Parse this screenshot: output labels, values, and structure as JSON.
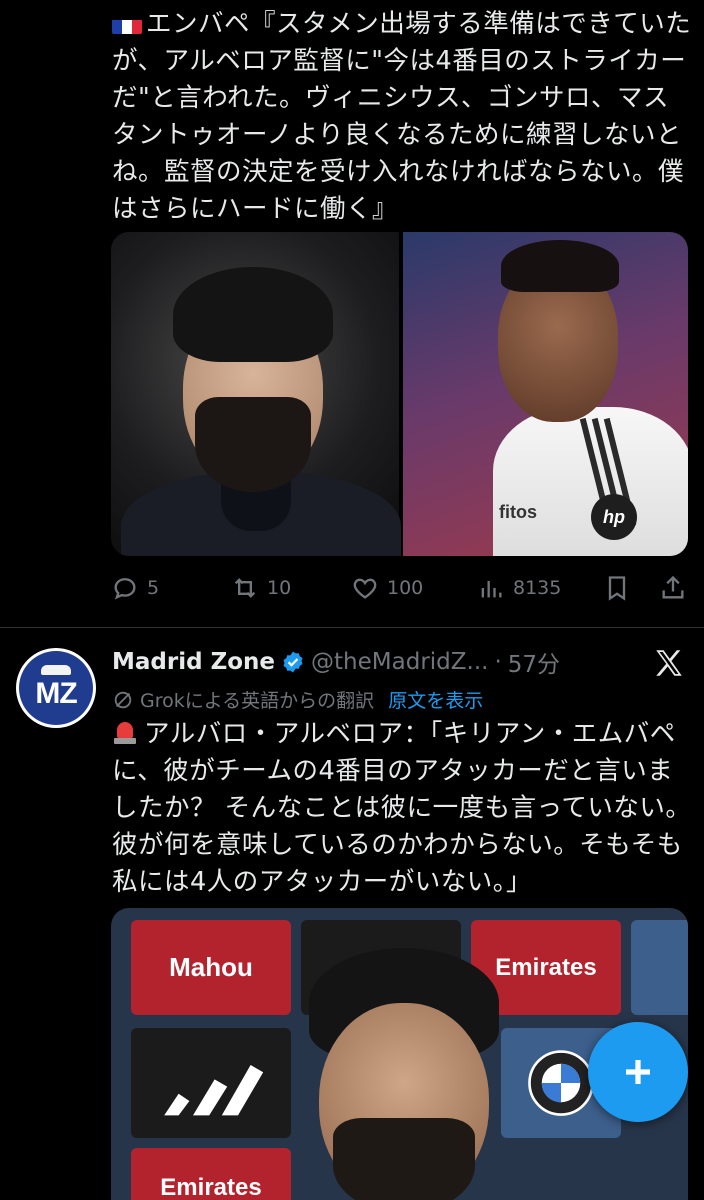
{
  "tweet1": {
    "flag_icon": "france-flag-icon",
    "text": "エンバペ『スタメン出場する準備はできていたが、アルベロア監督に\"今は4番目のストライカーだ\"と言われた。ヴィニシウス、ゴンサロ、マスタントゥオーノより良くなるために練習しないとね。監督の決定を受け入れなければならない。僕はさらにハードに働く』",
    "media_left_icon": "coach-photo",
    "media_right_icon": "player-photo",
    "jersey_text": "fitos",
    "jersey_logo": "hp",
    "actions": {
      "replies": "5",
      "retweets": "10",
      "likes": "100",
      "views": "8135"
    }
  },
  "tweet2": {
    "avatar_text": "MZ",
    "name": "Madrid Zone",
    "handle": "@theMadridZ...",
    "dot": "·",
    "time": "57分",
    "translation_label": "Grokによる英語からの翻訳",
    "show_original": "原文を表示",
    "text": "アルバロ・アルベロア：「キリアン・エムバペに、彼がチームの4番目のアタッカーだと言いましたか？ そんなことは彼に一度も言っていない。彼が何を意味しているのかわからない。そもそも私には4人のアタッカーがいない。」",
    "media": {
      "board_mahou": "Mahou",
      "board_emirates_1": "Emirates",
      "board_emirates_2": "Emirates"
    }
  },
  "colors": {
    "background": "#000000",
    "text": "#e7e9ea",
    "muted": "#71767b",
    "accent": "#1d9bf0"
  }
}
